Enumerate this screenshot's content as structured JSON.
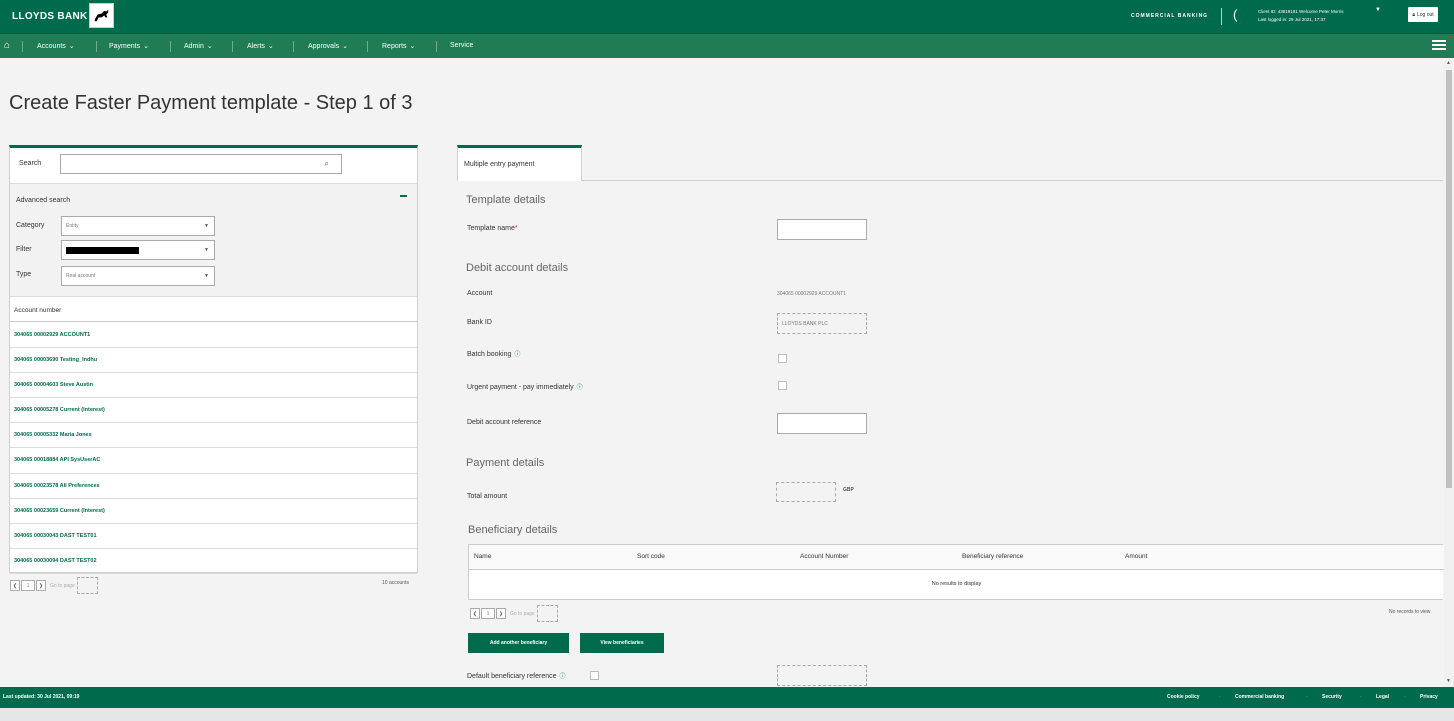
{
  "header": {
    "brand": "LLOYDS BANK",
    "product": "COMMERCIAL BANKING",
    "client_line": "Client ID: 43819181   Welcome Peter Morris",
    "last_logged": "Last logged in: 29 Jul 2021, 17:37",
    "logout": "Log out"
  },
  "nav": {
    "items": [
      {
        "label": "Accounts",
        "caret": "❯"
      },
      {
        "label": "Payments",
        "caret": "❯"
      },
      {
        "label": "Admin",
        "caret": "❯"
      },
      {
        "label": "Alerts",
        "caret": "❯"
      },
      {
        "label": "Approvals",
        "caret": "❯"
      },
      {
        "label": "Reports",
        "caret": "❯"
      },
      {
        "label": "Service"
      }
    ]
  },
  "page": {
    "title": "Create Faster Payment template - Step 1 of 3"
  },
  "search_panel": {
    "search_label": "Search",
    "search_value": "",
    "advanced_label": "Advanced search",
    "category_label": "Category",
    "category_value": "Entity",
    "filter_label": "Filter",
    "type_label": "Type",
    "type_value": "Real account",
    "column_header": "Account number",
    "accounts": [
      "304065 00002929 ACCOUNT1",
      "304065 00003690 Testing_Indhu",
      "304065 00004603 Steve Austin",
      "304065 00005278 Current (Interest)",
      "304065 00005332 Maria Jones",
      "304065 00018884 API SysUserAC",
      "304065 00023578 All Preferences",
      "304065 00023659 Current (Interest)",
      "304065 00030043 DAST TEST01",
      "304065 00030094 DAST TEST02"
    ],
    "pager": {
      "page": "1",
      "go_to_page": "Go to page"
    },
    "count": "10 accounts"
  },
  "form": {
    "tab": "Multiple entry payment",
    "template_section": "Template details",
    "template_name_label": "Template name",
    "required_mark": "*",
    "debit_section": "Debit account details",
    "account_label": "Account",
    "account_value": "304065 00002929 ACCOUNT1",
    "bank_id_label": "Bank ID",
    "bank_id_value": "LLOYDS BANK PLC",
    "batch_booking_label": "Batch booking",
    "urgent_label": "Urgent payment - pay immediately",
    "debit_ref_label": "Debit account reference",
    "payment_section": "Payment details",
    "total_amount_label": "Total amount",
    "currency": "GBP",
    "beneficiary_section": "Beneficiary details",
    "beneficiary_columns": [
      "Name",
      "Sort code",
      "Account Number",
      "Beneficiary reference",
      "Amount"
    ],
    "beneficiary_empty": "No results to display",
    "beneficiary_pager": {
      "page": "1",
      "go_to_page": "Go to page"
    },
    "no_records": "No records to view",
    "add_beneficiary_button": "Add another beneficiary",
    "view_beneficiaries_button": "View beneficiaries",
    "default_ref_label": "Default beneficiary reference",
    "info_icon": "ⓘ"
  },
  "footer": {
    "last_updated": "Last updated: 30 Jul 2021, 09:19",
    "links": [
      "Cookie policy",
      "Commercial banking",
      "Security",
      "Legal",
      "Privacy"
    ]
  },
  "colors": {
    "brand_green": "#006a4d",
    "nav_green": "#207c54"
  }
}
